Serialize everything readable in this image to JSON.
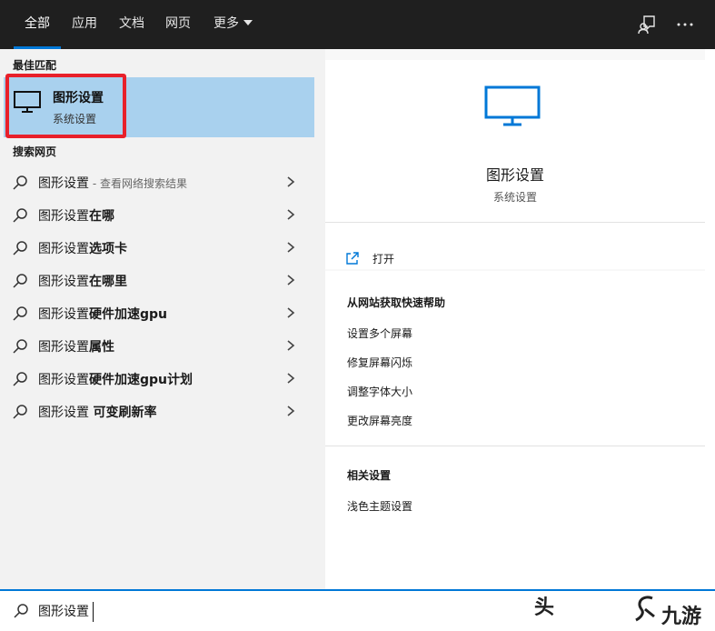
{
  "tabs": [
    {
      "label": "全部"
    },
    {
      "label": "应用"
    },
    {
      "label": "文档"
    },
    {
      "label": "网页"
    },
    {
      "label": "更多"
    }
  ],
  "icons": {
    "feedback": "feedback-icon",
    "more": "more-options-icon",
    "monitor": "monitor-icon",
    "search": "search-icon",
    "chevron": "chevron-right-icon",
    "open": "open-icon"
  },
  "colors": {
    "accent": "#0078d7",
    "selected_bg": "#a9d1ee",
    "highlight_outline": "#e8202a",
    "topbar_bg": "#1f1f1f"
  },
  "left": {
    "best_match_label": "最佳匹配",
    "best_match": {
      "title": "图形设置",
      "subtitle": "系统设置"
    },
    "web_label": "搜索网页",
    "web_results": [
      {
        "normal": "图形设置",
        "bold": "",
        "hint": " - 查看网络搜索结果"
      },
      {
        "normal": "图形设置",
        "bold": "在哪",
        "hint": ""
      },
      {
        "normal": "图形设置",
        "bold": "选项卡",
        "hint": ""
      },
      {
        "normal": "图形设置",
        "bold": "在哪里",
        "hint": ""
      },
      {
        "normal": "图形设置",
        "bold": "硬件加速gpu",
        "hint": ""
      },
      {
        "normal": "图形设置",
        "bold": "属性",
        "hint": ""
      },
      {
        "normal": "图形设置",
        "bold": "硬件加速gpu计划",
        "hint": ""
      },
      {
        "normal": "图形设置 ",
        "bold": "可变刷新率",
        "hint": ""
      }
    ]
  },
  "right": {
    "title": "图形设置",
    "subtitle": "系统设置",
    "open_label": "打开",
    "help_heading": "从网站获取快速帮助",
    "help_links": [
      "设置多个屏幕",
      "修复屏幕闪烁",
      "调整字体大小",
      "更改屏幕亮度"
    ],
    "related_heading": "相关设置",
    "related_links": [
      "浅色主题设置"
    ]
  },
  "search": {
    "value": "图形设置"
  },
  "watermark": {
    "left": "头",
    "right": "九游"
  }
}
